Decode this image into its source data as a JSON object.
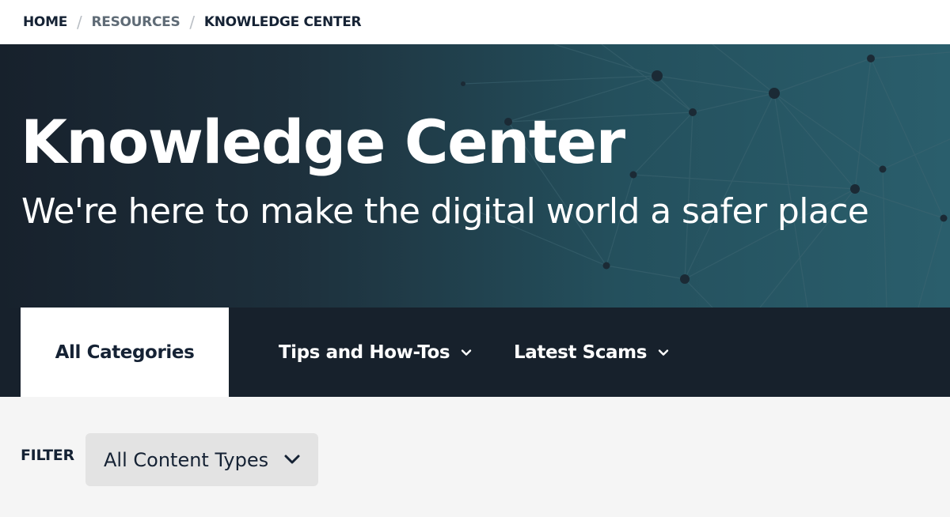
{
  "breadcrumb": {
    "home": "HOME",
    "resources": "RESOURCES",
    "current": "KNOWLEDGE CENTER",
    "separator": "/"
  },
  "hero": {
    "title": "Knowledge Center",
    "subtitle": "We're here to make the digital world a safer place"
  },
  "tabs": [
    {
      "label": "All Categories",
      "active": true
    },
    {
      "label": "Tips and How-Tos",
      "has_dropdown": true
    },
    {
      "label": "Latest Scams",
      "has_dropdown": true
    }
  ],
  "filter": {
    "label": "FILTER",
    "selected": "All Content Types"
  },
  "colors": {
    "navy": "#152234",
    "hero_dark": "#17212c",
    "hero_teal": "#2a5e6c",
    "filter_bg": "#e3e3e3"
  },
  "icons": {
    "dropdown": "chevron-down-icon"
  }
}
